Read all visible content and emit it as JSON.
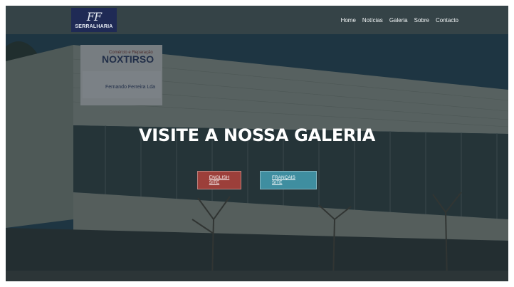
{
  "brand": {
    "logo_mark": "FF",
    "logo_text": "SERRALHARIA"
  },
  "nav": {
    "items": [
      {
        "label": "Home"
      },
      {
        "label": "Notícias"
      },
      {
        "label": "Galeria"
      },
      {
        "label": "Sobre"
      },
      {
        "label": "Contacto"
      }
    ]
  },
  "hero": {
    "title": "VISITE A NOSSA GALERIA",
    "buttons": {
      "english": "ENGLISH SITE",
      "french": "FRANÇAIS SITE"
    },
    "signs": {
      "top": "Comércio e Reparação",
      "company": "NOXTIRSO",
      "sub": "Fernando Ferreira Lda"
    }
  },
  "colors": {
    "english_button": "#9c3f3a",
    "french_button": "#3f8ea0",
    "navbar": "#374448",
    "logo_bg": "#1f2a55"
  }
}
